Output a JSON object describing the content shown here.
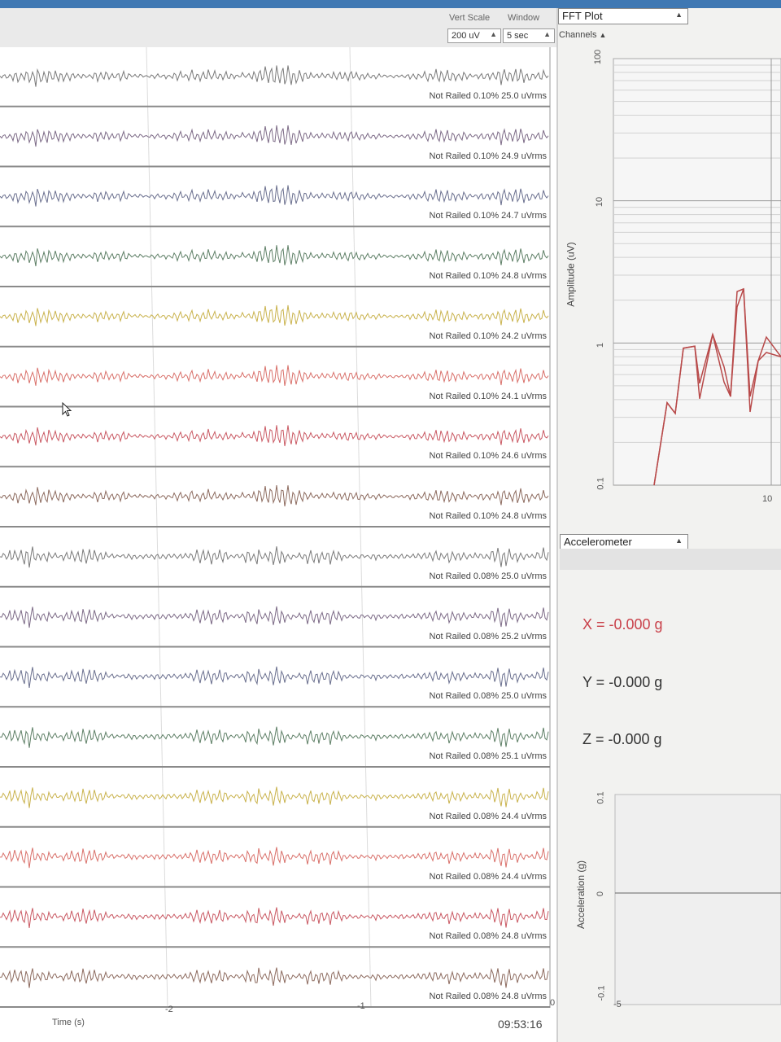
{
  "header": {
    "vert_scale_label": "Vert Scale",
    "window_label": "Window",
    "vert_scale_value": "200 uV",
    "window_value": "5 sec"
  },
  "time_series": {
    "channels": [
      {
        "status": "Not Railed 0.10% 25.0 uVrms",
        "color": "#7a7a7a"
      },
      {
        "status": "Not Railed 0.10% 24.9 uVrms",
        "color": "#7c6a86"
      },
      {
        "status": "Not Railed 0.10% 24.7 uVrms",
        "color": "#6a6f8e"
      },
      {
        "status": "Not Railed 0.10% 24.8 uVrms",
        "color": "#5e7f66"
      },
      {
        "status": "Not Railed 0.10% 24.2 uVrms",
        "color": "#c9b24c"
      },
      {
        "status": "Not Railed 0.10% 24.1 uVrms",
        "color": "#d9706a"
      },
      {
        "status": "Not Railed 0.10% 24.6 uVrms",
        "color": "#c95862"
      },
      {
        "status": "Not Railed 0.10% 24.8 uVrms",
        "color": "#8c6a5e"
      },
      {
        "status": "Not Railed 0.08% 25.0 uVrms",
        "color": "#7a7a7a"
      },
      {
        "status": "Not Railed 0.08% 25.2 uVrms",
        "color": "#7c6a86"
      },
      {
        "status": "Not Railed 0.08% 25.0 uVrms",
        "color": "#6a6f8e"
      },
      {
        "status": "Not Railed 0.08% 25.1 uVrms",
        "color": "#5e7f66"
      },
      {
        "status": "Not Railed 0.08% 24.4 uVrms",
        "color": "#c9b24c"
      },
      {
        "status": "Not Railed 0.08% 24.4 uVrms",
        "color": "#d9706a"
      },
      {
        "status": "Not Railed 0.08% 24.8 uVrms",
        "color": "#c95862"
      },
      {
        "status": "Not Railed 0.08% 24.8 uVrms",
        "color": "#8c6a5e"
      }
    ],
    "x_ticks": [
      "-2",
      "-1",
      "0"
    ],
    "x_label": "Time (s)",
    "clock": "09:53:16"
  },
  "fft_panel": {
    "title": "FFT Plot",
    "channels_label": "Channels",
    "y_label": "Amplitude (uV)",
    "y_ticks": [
      "100",
      "10",
      "1",
      "0.1"
    ],
    "x_tick": "10",
    "trace_color": "#b84a4a"
  },
  "accelerometer": {
    "title": "Accelerometer",
    "x_text": "X = -0.000 g",
    "y_text": "Y = -0.000 g",
    "z_text": "Z = -0.000 g",
    "x_color": "#c9414a",
    "y_color": "#333333",
    "z_color": "#333333",
    "y_label": "Acceleration (g)",
    "y_ticks": [
      "0.1",
      "0",
      "-0.1"
    ],
    "x_tick": "-5"
  },
  "icons": {
    "cursor": "mouse-pointer-icon",
    "dropdown_caret": "caret-up-icon"
  }
}
